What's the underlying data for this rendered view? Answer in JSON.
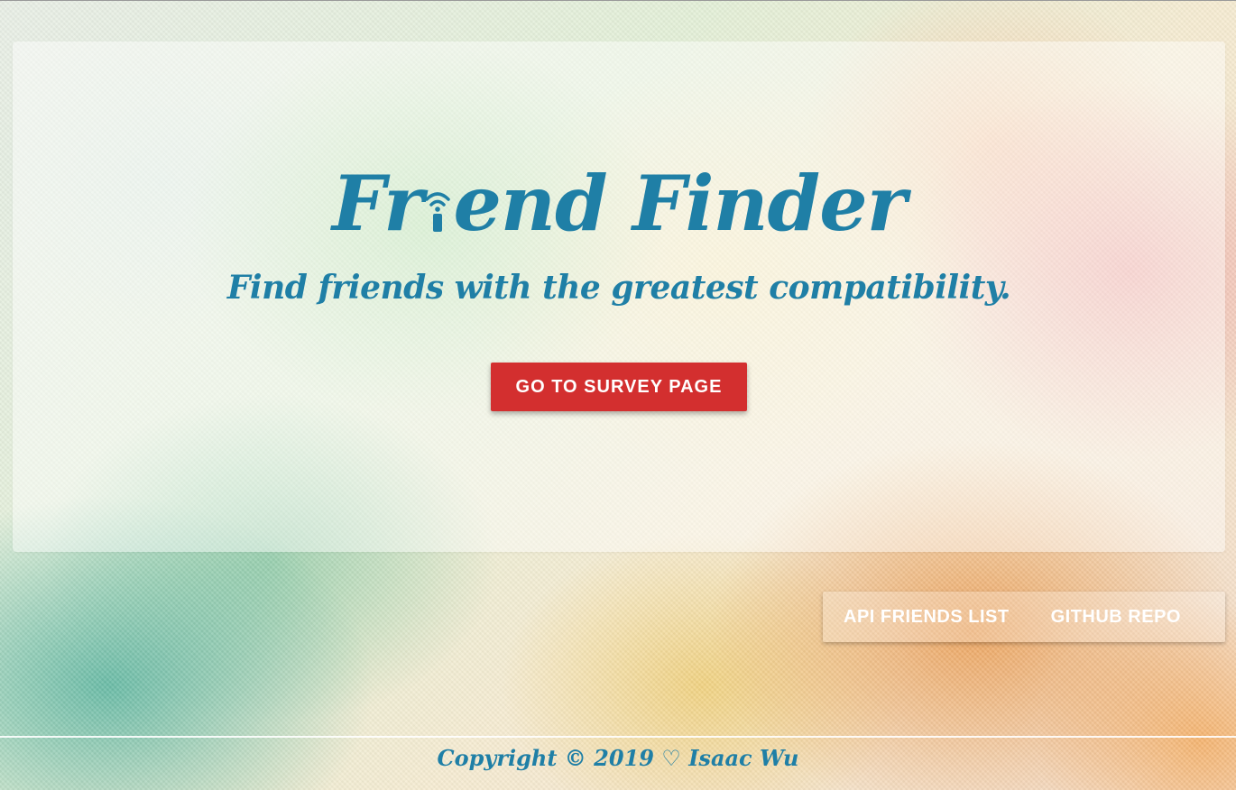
{
  "hero": {
    "title_part1": "Fr",
    "title_part2": "end Finder",
    "title_icon": "wifi-i-icon",
    "subtitle": "Find friends with the greatest compatibility.",
    "survey_button_label": "GO TO SURVEY PAGE"
  },
  "nav": {
    "links": [
      {
        "label": "API FRIENDS LIST"
      },
      {
        "label": "GITHUB REPO"
      }
    ]
  },
  "footer": {
    "copyright_label": "Copyright ©",
    "year": "2019",
    "heart_icon": "heart-outline-icon",
    "author": "Isaac Wu"
  },
  "colors": {
    "accent": "#1f7fa6",
    "button": "#d32f2f",
    "link_text": "#ffffff"
  }
}
